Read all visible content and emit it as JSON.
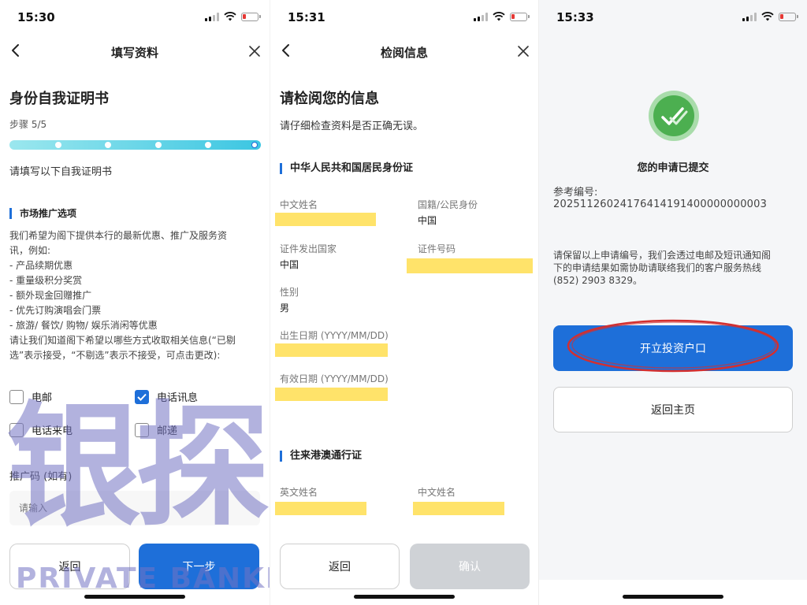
{
  "screen1": {
    "time": "15:30",
    "nav_title": "填写资料",
    "heading": "身份自我证明书",
    "step": "步骤 5/5",
    "progress": {
      "current": 5,
      "total": 5
    },
    "subheading": "请填写以下自我证明书",
    "section_title": "市场推广选项",
    "description_lines": [
      "我们希望为阁下提供本行的最新优惠、推广及服务资",
      "讯，例如:",
      "- 产品续期优惠",
      "- 重量级积分奖赏",
      "- 额外现金回赠推广",
      "- 优先订购演唱会门票",
      "- 旅游/ 餐饮/ 购物/ 娱乐消闲等优惠",
      "请让我们知道阁下希望以哪些方式收取相关信息(“已剔",
      "选”表示接受，“不剔选”表示不接受，可点击更改):"
    ],
    "options": [
      {
        "label": "电邮",
        "checked": false
      },
      {
        "label": "电话讯息",
        "checked": true
      },
      {
        "label": "电话来电",
        "checked": false
      },
      {
        "label": "邮递",
        "checked": false
      }
    ],
    "referral_label": "推广码 (如有)",
    "referral_placeholder": "请输入",
    "back_button": "返回",
    "next_button": "下一步",
    "watermark_big": "银探",
    "watermark_small": "PRIVATE BANKER"
  },
  "screen2": {
    "time": "15:31",
    "nav_title": "检阅信息",
    "heading": "请检阅您的信息",
    "subheading": "请仔细检查资料是否正确无误。",
    "section1_title": "中华人民共和国居民身份证",
    "fields": {
      "chinese_name": {
        "label": "中文姓名"
      },
      "nationality": {
        "label": "国籍/公民身份",
        "value": "中国"
      },
      "issuing_country": {
        "label": "证件发出国家",
        "value": "中国"
      },
      "id_number": {
        "label": "证件号码"
      },
      "gender": {
        "label": "性别",
        "value": "男"
      },
      "dob": {
        "label": "出生日期 (YYYY/MM/DD)"
      },
      "expiry": {
        "label": "有效日期 (YYYY/MM/DD)"
      }
    },
    "section2_title": "往来港澳通行证",
    "fields2": {
      "english_name": {
        "label": "英文姓名"
      },
      "chinese_name": {
        "label": "中文姓名"
      }
    },
    "back_button": "返回",
    "confirm_button": "确认"
  },
  "screen3": {
    "time": "15:33",
    "submitted_text": "您的申请已提交",
    "reference_label": "参考编号:",
    "reference_number": "20251126024176414191400000000003",
    "notice_lines": [
      "请保留以上申请编号，我们会透过电邮及短讯通知阁",
      "下的申请结果如需协助请联络我们的客户服务热线",
      "(852) 2903 8329。"
    ],
    "open_account_button": "开立投资户口",
    "home_button": "返回主页"
  },
  "colors": {
    "primary": "#1e6fd9",
    "success": "#4caf50",
    "mask": "#ffe36a",
    "annotation": "#d32f2f"
  }
}
